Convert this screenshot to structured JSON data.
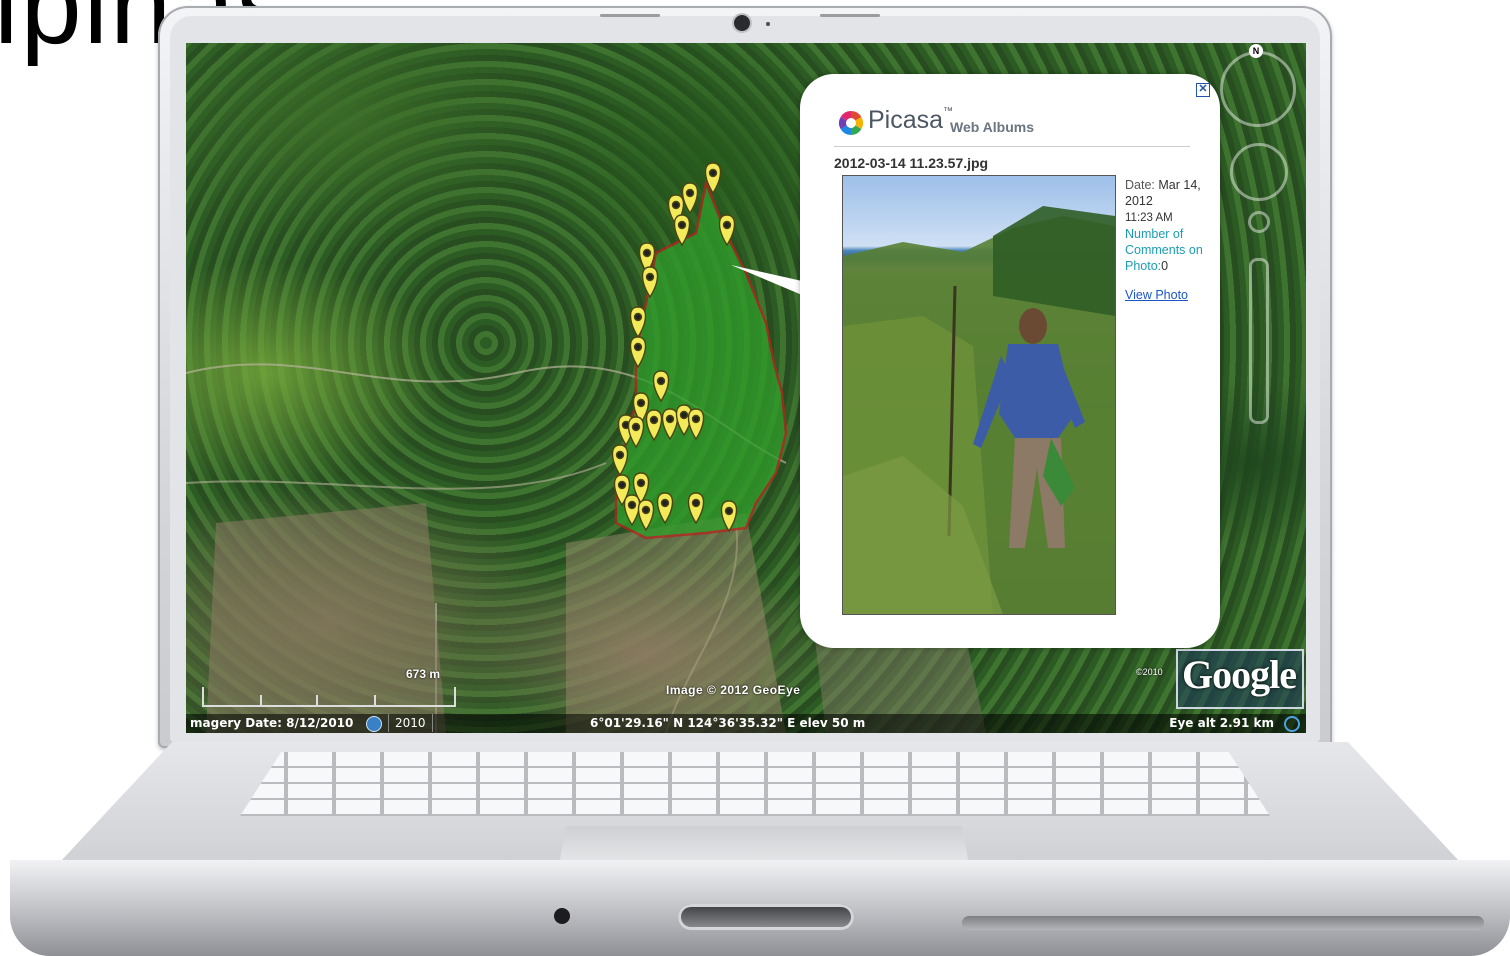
{
  "slide": {
    "title_fragment": "ipinas"
  },
  "map": {
    "scale_label": "673 m",
    "image_credit": "Image © 2012 GeoEye",
    "statusbar": {
      "imagery_date": "magery Date: 8/12/2010",
      "year": "2010",
      "coordinates": "6°01'29.16\" N 124°36'35.32\" E elev   50 m",
      "eye_alt": "Eye alt    2.91 km"
    },
    "google_logo": "Google",
    "google_copyright": "©2010",
    "nav_north": "N",
    "colors": {
      "polygon_fill": "#2f9c2a",
      "polygon_border": "#b3261e",
      "placemark": "#f2ea5a"
    }
  },
  "popup": {
    "close_label": "✕",
    "brand": "Picasa",
    "brand_tm": "™",
    "brand_sub": "Web Albums",
    "filename": "2012-03-14 11.23.57.jpg",
    "date_label": "Date:",
    "date_value": "Mar 14, 2012",
    "time_value": "11:23 AM",
    "comments_label": "Number of Comments on Photo:",
    "comments_value": "0",
    "view_photo_link": "View Photo"
  }
}
